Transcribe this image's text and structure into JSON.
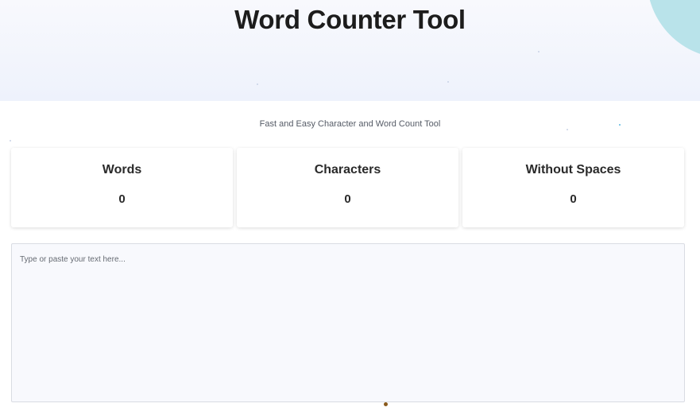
{
  "header": {
    "title": "Word Counter Tool"
  },
  "subtitle": "Fast and Easy Character and Word Count Tool",
  "stats": [
    {
      "label": "Words",
      "value": "0"
    },
    {
      "label": "Characters",
      "value": "0"
    },
    {
      "label": "Without Spaces",
      "value": "0"
    }
  ],
  "editor": {
    "placeholder": "Type or paste your text here...",
    "value": ""
  },
  "colors": {
    "hero_background": "#eef2fc",
    "accent_blob": "#b9e3ea",
    "editor_background": "#f8f9fd"
  }
}
